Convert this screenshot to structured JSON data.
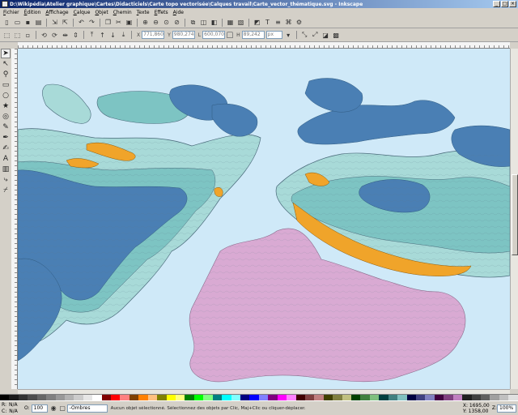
{
  "window": {
    "title": "D:\\Wikipédia\\Atelier graphique\\Cartes\\Didacticiels\\Carte topo vectorisée\\Calques travail\\Carte_vector_thématique.svg - Inkscape",
    "buttons": [
      "_",
      "□",
      "×"
    ]
  },
  "menu": {
    "items": [
      {
        "acc": "F",
        "rest": "ichier"
      },
      {
        "acc": "É",
        "rest": "dition"
      },
      {
        "acc": "A",
        "rest": "ffichage"
      },
      {
        "acc": "C",
        "rest": "alque"
      },
      {
        "acc": "O",
        "rest": "bjet"
      },
      {
        "acc": "C",
        "rest": "hemin"
      },
      {
        "acc": "T",
        "rest": "exte"
      },
      {
        "acc": "E",
        "rest": "ffets"
      },
      {
        "acc": "A",
        "rest": "ide"
      }
    ]
  },
  "toolbar2": {
    "x_label": "X",
    "x_value": "771,860",
    "y_label": "Y",
    "y_value": "980,274",
    "w_label": "L",
    "w_value": "600,070",
    "h_label": "H",
    "h_value": "89,242",
    "unit": "px"
  },
  "status": {
    "fill_label": "R:",
    "fill_value": "N/A",
    "stroke_label": "C:",
    "stroke_value": "N/A",
    "opacity_label": "O:",
    "opacity_value": "100",
    "layer": "-Ombres",
    "message": "Aucun objet sélectionné. Sélectionnez des objets par Clic, Maj+Clic ou cliquer-déplacer.",
    "x_label": "X:",
    "x_value": "1695,00",
    "y_label": "Y:",
    "y_value": "1358,00",
    "zoom_label": "Z:",
    "zoom": "100%"
  },
  "icons": {
    "toolbar1": [
      "new-icon",
      "open-icon",
      "save-icon",
      "print-icon",
      "import-icon",
      "export-icon",
      "undo-icon",
      "redo-icon",
      "copy-icon",
      "cut-icon",
      "paste-icon",
      "zoom-selection-icon",
      "zoom-drawing-icon",
      "zoom-page-icon",
      "duplicate-icon",
      "clone-icon",
      "unlink-clone-icon",
      "group-icon",
      "ungroup-icon",
      "fill-stroke-icon",
      "text-font-icon",
      "align-icon",
      "xml-editor-icon",
      "preferences-icon"
    ],
    "tools": [
      "selector-icon",
      "node-icon",
      "zoom-icon",
      "rectangle-icon",
      "ellipse-icon",
      "star-icon",
      "spiral-icon",
      "pencil-icon",
      "pen-icon",
      "calligraphy-icon",
      "text-icon",
      "gradient-icon",
      "connector-icon",
      "dropper-icon"
    ]
  },
  "colors": {
    "sea": "#cfe9f8",
    "shallow": "#a8dad8",
    "mid": "#7dc4c3",
    "deep": "#4a7fb4",
    "orange": "#f0a42a",
    "mauve": "#d9aad3",
    "contour": "#5a7a8a"
  },
  "palette": [
    "#000000",
    "#1a1a1a",
    "#333333",
    "#4d4d4d",
    "#666666",
    "#808080",
    "#999999",
    "#b3b3b3",
    "#cccccc",
    "#e6e6e6",
    "#ffffff",
    "#800000",
    "#ff0000",
    "#ff8080",
    "#804000",
    "#ff8000",
    "#ffc080",
    "#808000",
    "#ffff00",
    "#ffff80",
    "#008000",
    "#00ff00",
    "#80ff80",
    "#008080",
    "#00ffff",
    "#80ffff",
    "#000080",
    "#0000ff",
    "#8080ff",
    "#800080",
    "#ff00ff",
    "#ff80ff",
    "#400000",
    "#804040",
    "#c08080",
    "#404000",
    "#808040",
    "#c0c080",
    "#004000",
    "#408040",
    "#80c080",
    "#004040",
    "#408080",
    "#80c0c0",
    "#000040",
    "#404080",
    "#8080c0",
    "#400040",
    "#804080",
    "#c080c0",
    "#202020",
    "#404040",
    "#606060",
    "#a0a0a0",
    "#c0c0c0",
    "#e0e0e0"
  ]
}
